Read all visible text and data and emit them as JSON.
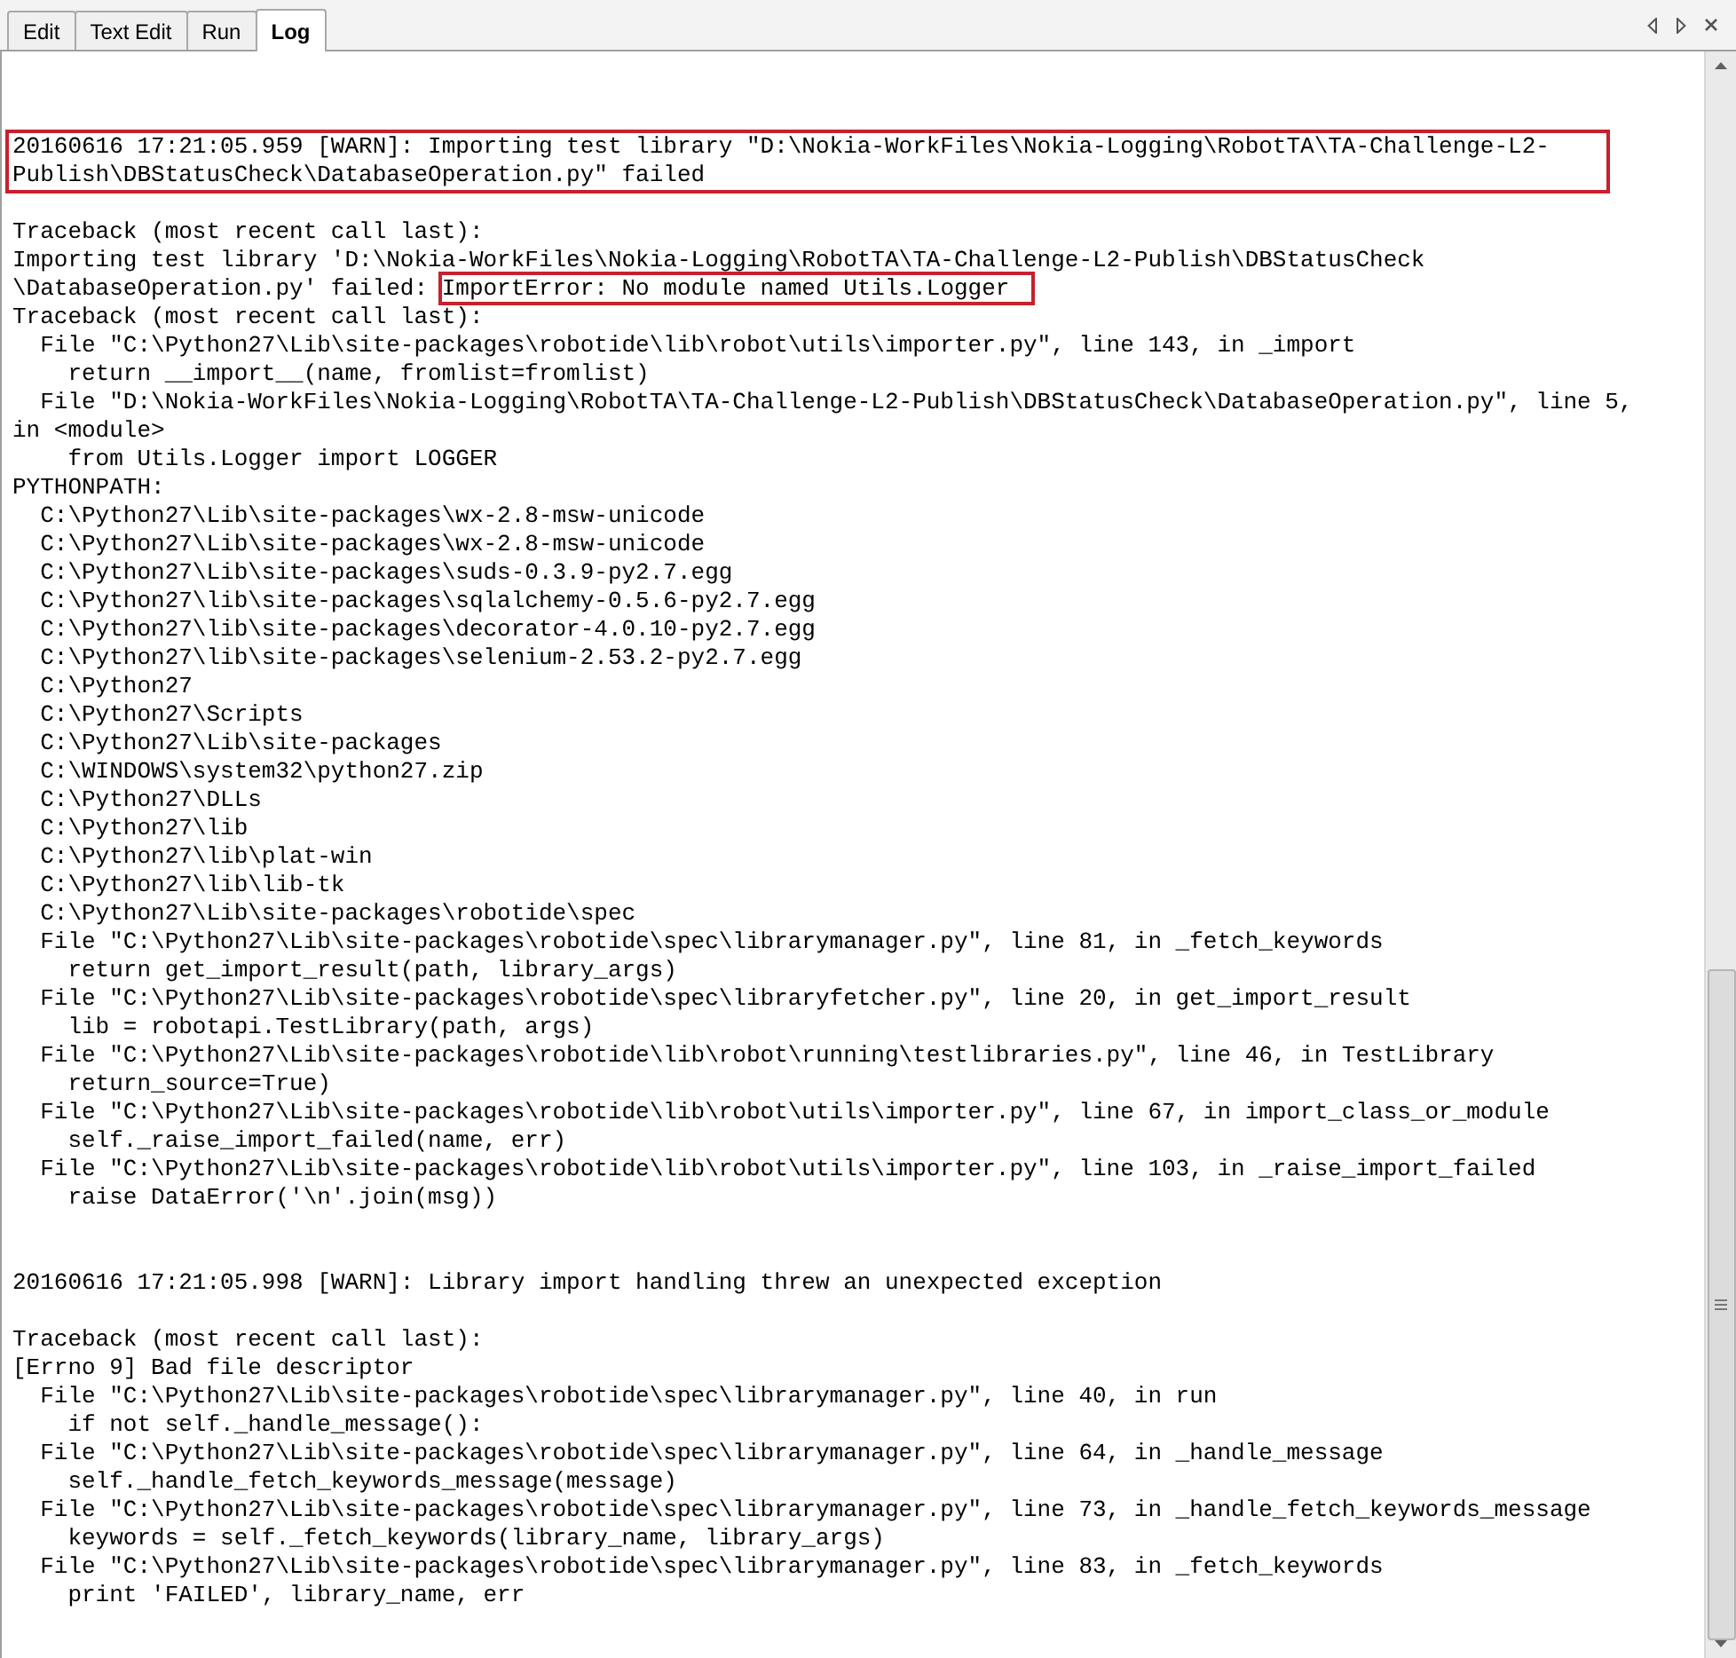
{
  "tabs": [
    {
      "label": "Edit",
      "selected": false
    },
    {
      "label": "Text Edit",
      "selected": false
    },
    {
      "label": "Run",
      "selected": false
    },
    {
      "label": "Log",
      "selected": true
    }
  ],
  "log": [
    {
      "kind": "boxed",
      "lines": [
        "20160616 17:21:05.959 [WARN]: Importing test library \"D:\\Nokia-WorkFiles\\Nokia-Logging\\RobotTA\\TA-Challenge-L2-",
        "Publish\\DBStatusCheck\\DatabaseOperation.py\" failed"
      ]
    },
    {
      "kind": "blank"
    },
    {
      "kind": "line",
      "text": "Traceback (most recent call last):"
    },
    {
      "kind": "line",
      "text": "Importing test library 'D:\\Nokia-WorkFiles\\Nokia-Logging\\RobotTA\\TA-Challenge-L2-Publish\\DBStatusCheck"
    },
    {
      "kind": "line",
      "text": "\\DatabaseOperation.py' failed: ",
      "marked": "ImportError: No module named Utils.Logger"
    },
    {
      "kind": "line",
      "text": "Traceback (most recent call last):"
    },
    {
      "kind": "line",
      "text": "  File \"C:\\Python27\\Lib\\site-packages\\robotide\\lib\\robot\\utils\\importer.py\", line 143, in _import"
    },
    {
      "kind": "line",
      "text": "    return __import__(name, fromlist=fromlist)"
    },
    {
      "kind": "line",
      "text": "  File \"D:\\Nokia-WorkFiles\\Nokia-Logging\\RobotTA\\TA-Challenge-L2-Publish\\DBStatusCheck\\DatabaseOperation.py\", line 5,"
    },
    {
      "kind": "line",
      "text": "in <module>"
    },
    {
      "kind": "line",
      "text": "    from Utils.Logger import LOGGER"
    },
    {
      "kind": "line",
      "text": "PYTHONPATH:"
    },
    {
      "kind": "line",
      "text": "  C:\\Python27\\Lib\\site-packages\\wx-2.8-msw-unicode"
    },
    {
      "kind": "line",
      "text": "  C:\\Python27\\Lib\\site-packages\\wx-2.8-msw-unicode"
    },
    {
      "kind": "line",
      "text": "  C:\\Python27\\Lib\\site-packages\\suds-0.3.9-py2.7.egg"
    },
    {
      "kind": "line",
      "text": "  C:\\Python27\\lib\\site-packages\\sqlalchemy-0.5.6-py2.7.egg"
    },
    {
      "kind": "line",
      "text": "  C:\\Python27\\lib\\site-packages\\decorator-4.0.10-py2.7.egg"
    },
    {
      "kind": "line",
      "text": "  C:\\Python27\\lib\\site-packages\\selenium-2.53.2-py2.7.egg"
    },
    {
      "kind": "line",
      "text": "  C:\\Python27"
    },
    {
      "kind": "line",
      "text": "  C:\\Python27\\Scripts"
    },
    {
      "kind": "line",
      "text": "  C:\\Python27\\Lib\\site-packages"
    },
    {
      "kind": "line",
      "text": "  C:\\WINDOWS\\system32\\python27.zip"
    },
    {
      "kind": "line",
      "text": "  C:\\Python27\\DLLs"
    },
    {
      "kind": "line",
      "text": "  C:\\Python27\\lib"
    },
    {
      "kind": "line",
      "text": "  C:\\Python27\\lib\\plat-win"
    },
    {
      "kind": "line",
      "text": "  C:\\Python27\\lib\\lib-tk"
    },
    {
      "kind": "line",
      "text": "  C:\\Python27\\Lib\\site-packages\\robotide\\spec"
    },
    {
      "kind": "line",
      "text": "  File \"C:\\Python27\\Lib\\site-packages\\robotide\\spec\\librarymanager.py\", line 81, in _fetch_keywords"
    },
    {
      "kind": "line",
      "text": "    return get_import_result(path, library_args)"
    },
    {
      "kind": "line",
      "text": "  File \"C:\\Python27\\Lib\\site-packages\\robotide\\spec\\libraryfetcher.py\", line 20, in get_import_result"
    },
    {
      "kind": "line",
      "text": "    lib = robotapi.TestLibrary(path, args)"
    },
    {
      "kind": "line",
      "text": "  File \"C:\\Python27\\Lib\\site-packages\\robotide\\lib\\robot\\running\\testlibraries.py\", line 46, in TestLibrary"
    },
    {
      "kind": "line",
      "text": "    return_source=True)"
    },
    {
      "kind": "line",
      "text": "  File \"C:\\Python27\\Lib\\site-packages\\robotide\\lib\\robot\\utils\\importer.py\", line 67, in import_class_or_module"
    },
    {
      "kind": "line",
      "text": "    self._raise_import_failed(name, err)"
    },
    {
      "kind": "line",
      "text": "  File \"C:\\Python27\\Lib\\site-packages\\robotide\\lib\\robot\\utils\\importer.py\", line 103, in _raise_import_failed"
    },
    {
      "kind": "line",
      "text": "    raise DataError('\\n'.join(msg))"
    },
    {
      "kind": "blank"
    },
    {
      "kind": "blank"
    },
    {
      "kind": "line",
      "text": "20160616 17:21:05.998 [WARN]: Library import handling threw an unexpected exception"
    },
    {
      "kind": "blank"
    },
    {
      "kind": "line",
      "text": "Traceback (most recent call last):"
    },
    {
      "kind": "line",
      "text": "[Errno 9] Bad file descriptor"
    },
    {
      "kind": "line",
      "text": "  File \"C:\\Python27\\Lib\\site-packages\\robotide\\spec\\librarymanager.py\", line 40, in run"
    },
    {
      "kind": "line",
      "text": "    if not self._handle_message():"
    },
    {
      "kind": "line",
      "text": "  File \"C:\\Python27\\Lib\\site-packages\\robotide\\spec\\librarymanager.py\", line 64, in _handle_message"
    },
    {
      "kind": "line",
      "text": "    self._handle_fetch_keywords_message(message)"
    },
    {
      "kind": "line",
      "text": "  File \"C:\\Python27\\Lib\\site-packages\\robotide\\spec\\librarymanager.py\", line 73, in _handle_fetch_keywords_message"
    },
    {
      "kind": "line",
      "text": "    keywords = self._fetch_keywords(library_name, library_args)"
    },
    {
      "kind": "line",
      "text": "  File \"C:\\Python27\\Lib\\site-packages\\robotide\\spec\\librarymanager.py\", line 83, in _fetch_keywords"
    },
    {
      "kind": "line",
      "text": "    print 'FAILED', library_name, err"
    }
  ]
}
